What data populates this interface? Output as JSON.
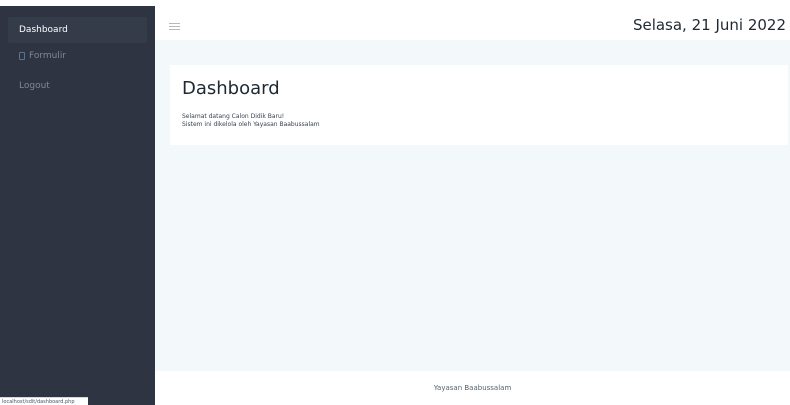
{
  "sidebar": {
    "items": [
      {
        "label": "Dashboard",
        "active": true
      },
      {
        "label": "Formulir",
        "icon": "form-icon"
      },
      {
        "label": "Logout"
      }
    ],
    "status_url": "localhost/sdit/dashboard.php"
  },
  "header": {
    "menu_icon": "hamburger-icon",
    "date": "Selasa, 21 Juni 2022"
  },
  "main": {
    "title": "Dashboard",
    "lines": [
      "Selamat datang Calon Didik Baru!",
      "Sistem ini dikelola oleh Yayasan Baabussalam"
    ]
  },
  "footer": {
    "text": "Yayasan Baabussalam"
  },
  "colors": {
    "sidebar_bg": "#2e3441",
    "page_bg": "#f3f8fa",
    "card_bg": "#ffffff"
  }
}
